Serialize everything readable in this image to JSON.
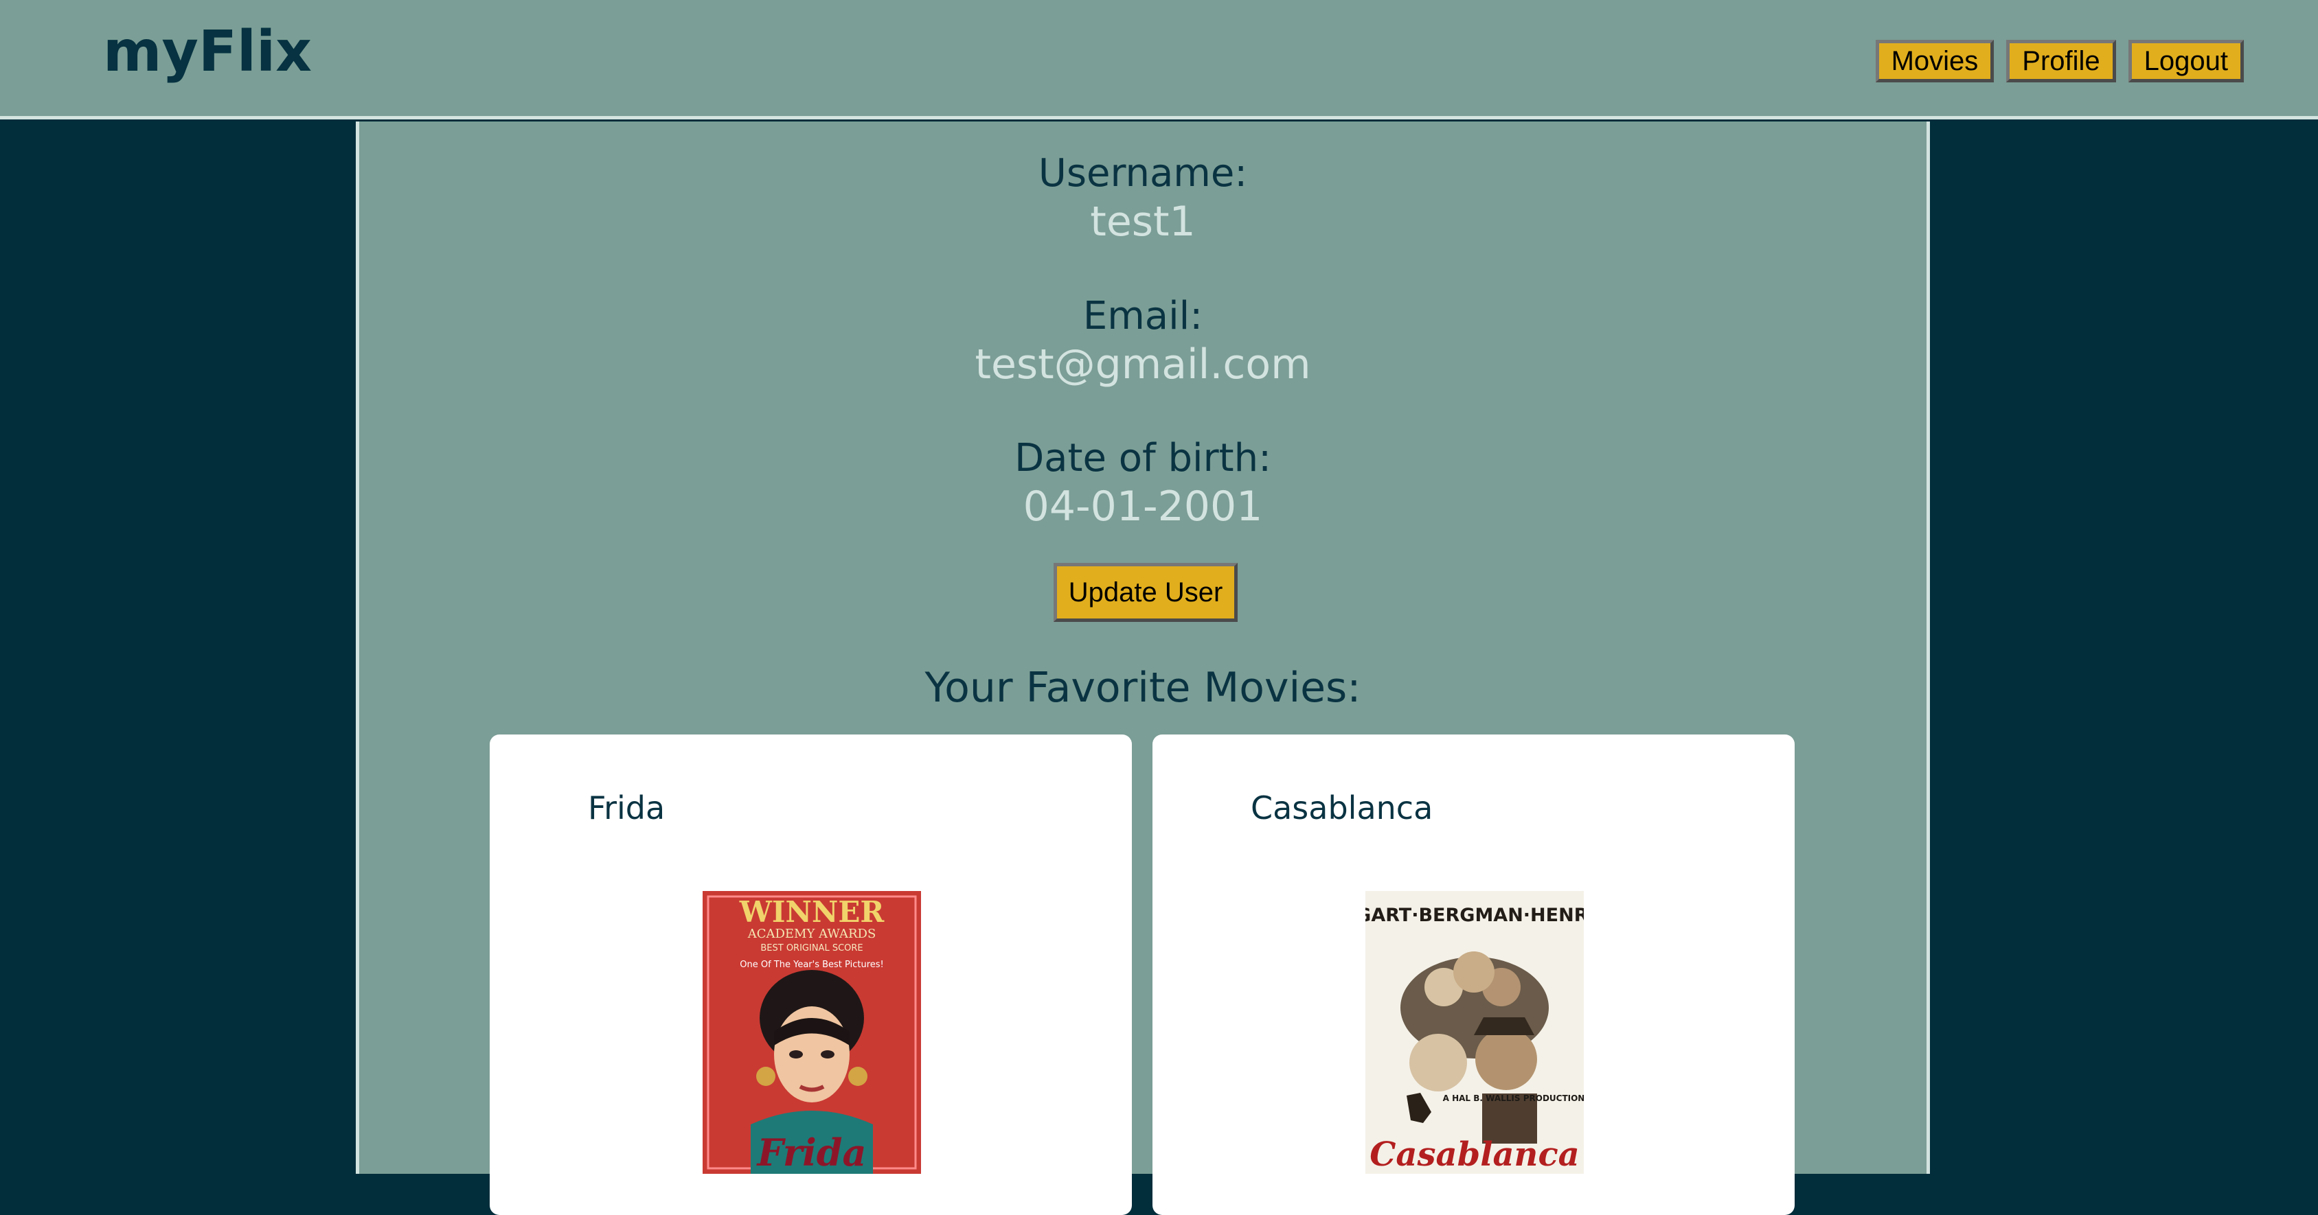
{
  "nav": {
    "brand": "myFlix",
    "buttons": [
      "Movies",
      "Profile",
      "Logout"
    ]
  },
  "profile": {
    "username_label": "Username:",
    "username": "test1",
    "email_label": "Email:",
    "email": "test@gmail.com",
    "dob_label": "Date of birth:",
    "dob": "04-01-2001",
    "update_label": "Update User"
  },
  "favorites": {
    "heading": "Your Favorite Movies:",
    "movies": [
      {
        "title": "Frida",
        "poster": {
          "top_text": "WINNER",
          "sub_text": "ACADEMY AWARDS",
          "caption": "BEST ORIGINAL SCORE",
          "tagline": "One Of The Year's Best Pictures!",
          "bottom_text": "Frida"
        }
      },
      {
        "title": "Casablanca",
        "poster": {
          "cast": "BOGART·BERGMAN·HENREID",
          "producer": "A HAL B. WALLIS PRODUCTION",
          "bottom_text": "Casablanca"
        }
      }
    ]
  },
  "colors": {
    "navbar": "#7b9e96",
    "background": "#022d3b",
    "button": "#e1ae1d",
    "label": "#0a3342",
    "value": "#d3e3df"
  }
}
